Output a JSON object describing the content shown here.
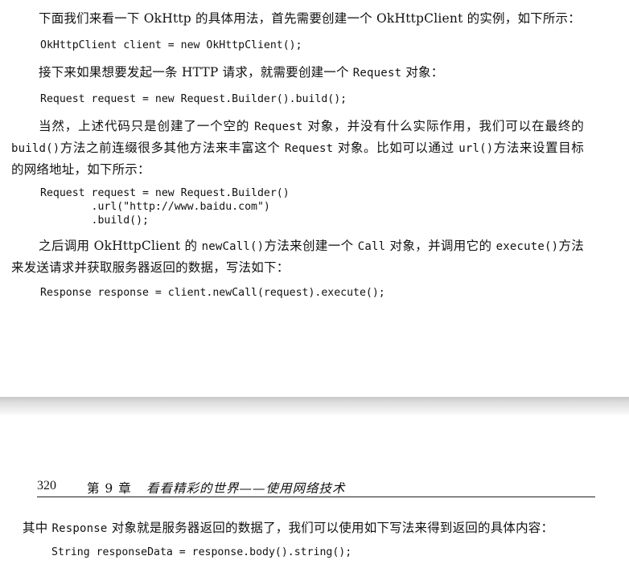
{
  "top_page": {
    "p1": "下面我们来看一下 OkHttp 的具体用法，首先需要创建一个 OkHttpClient 的实例，如下所示：",
    "code1": "OkHttpClient client = new OkHttpClient();",
    "p2_before": "接下来如果想要发起一条 HTTP 请求，就需要创建一个 ",
    "p2_code": "Request",
    "p2_after": " 对象：",
    "code2": "Request request = new Request.Builder().build();",
    "p3_a": "当然，上述代码只是创建了一个空的 ",
    "p3_code1": "Request",
    "p3_b": " 对象，并没有什么实际作用，我们可以在最终的 ",
    "p3_code2": "build()",
    "p3_c": "方法之前连缀很多其他方法来丰富这个 ",
    "p3_code3": "Request",
    "p3_d": " 对象。比如可以通过 ",
    "p3_code4": "url()",
    "p3_e": "方法来设置目标的网络地址，如下所示：",
    "code3": "Request request = new Request.Builder()\n        .url(\"http://www.baidu.com\")\n        .build();",
    "p4_a": "之后调用 OkHttpClient 的 ",
    "p4_code1": "newCall()",
    "p4_b": "方法来创建一个 ",
    "p4_code2": "Call",
    "p4_c": " 对象，并调用它的 ",
    "p4_code3": "execute()",
    "p4_d": "方法来发送请求并获取服务器返回的数据，写法如下：",
    "code4": "Response response = client.newCall(request).execute();"
  },
  "bottom_page": {
    "page_number": "320",
    "chapter": "第 9 章",
    "chapter_title": "看看精彩的世界——使用网络技术",
    "p5_a": "其中 ",
    "p5_code": "Response",
    "p5_b": " 对象就是服务器返回的数据了，我们可以使用如下写法来得到返回的具体内容：",
    "code5": "String responseData = response.body().string();"
  }
}
